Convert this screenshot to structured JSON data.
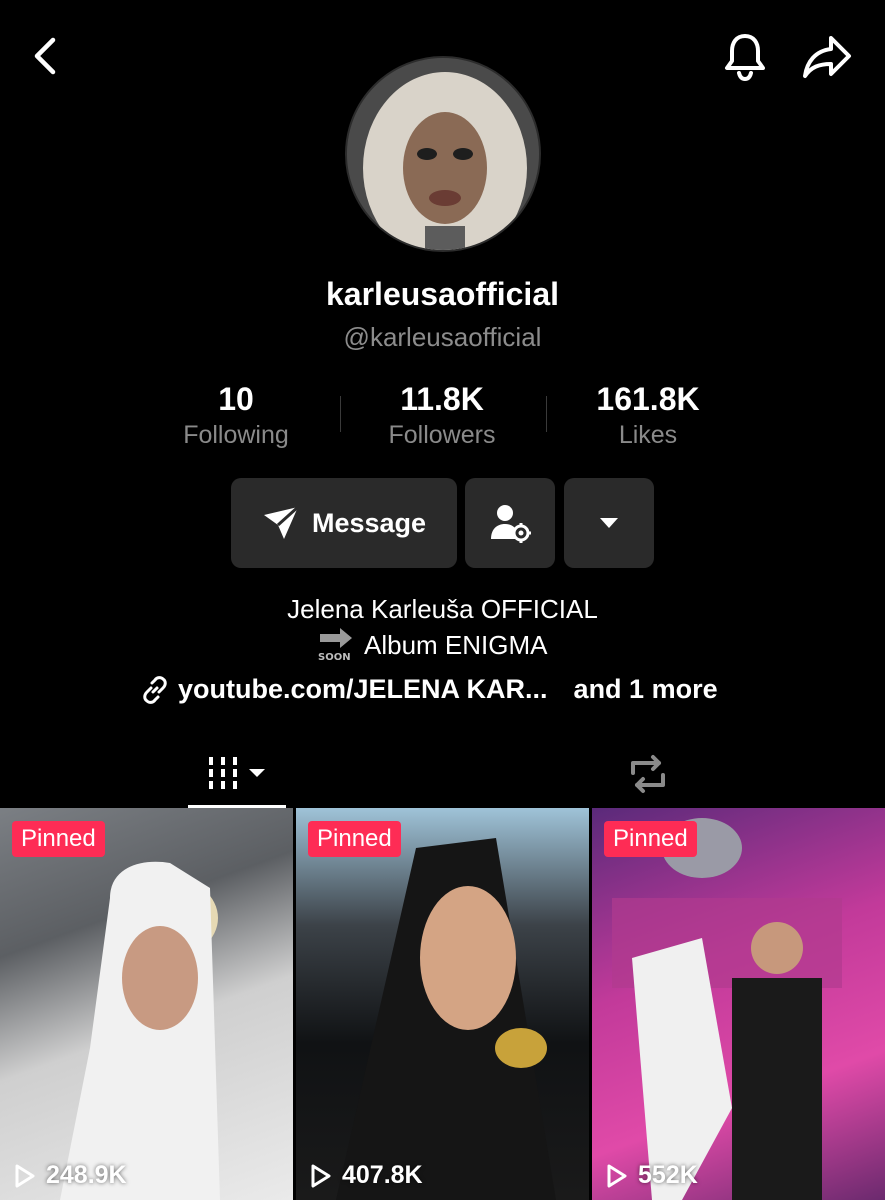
{
  "header": {
    "back_icon": "chevron-left-icon",
    "bell_icon": "bell-icon",
    "share_icon": "share-arrow-icon"
  },
  "profile": {
    "display_name": "karleusaofficial",
    "handle": "@karleusaofficial"
  },
  "stats": [
    {
      "value": "10",
      "label": "Following"
    },
    {
      "value": "11.8K",
      "label": "Followers"
    },
    {
      "value": "161.8K",
      "label": "Likes"
    }
  ],
  "actions": {
    "message_label": "Message",
    "message_icon": "send-plane-icon",
    "friend_settings_icon": "user-gear-icon",
    "more_icon": "caret-down-icon"
  },
  "bio": {
    "line1": "Jelena Karleuša OFFICIAL",
    "soon_badge": "SOON",
    "line2": "Album ENIGMA",
    "link_text": "youtube.com/JELENA KAR...",
    "link_more": "and 1 more"
  },
  "tabs": [
    {
      "icon": "video-grid-icon",
      "active": true
    },
    {
      "icon": "repost-icon",
      "active": false
    }
  ],
  "videos": [
    {
      "badge": "Pinned",
      "views": "248.9K"
    },
    {
      "badge": "Pinned",
      "views": "407.8K"
    },
    {
      "badge": "Pinned",
      "views": "552K"
    }
  ],
  "colors": {
    "background": "#000000",
    "button_bg": "#2a2a2a",
    "pinned_badge": "#fe2c55",
    "secondary_text": "#8a8a8a"
  }
}
